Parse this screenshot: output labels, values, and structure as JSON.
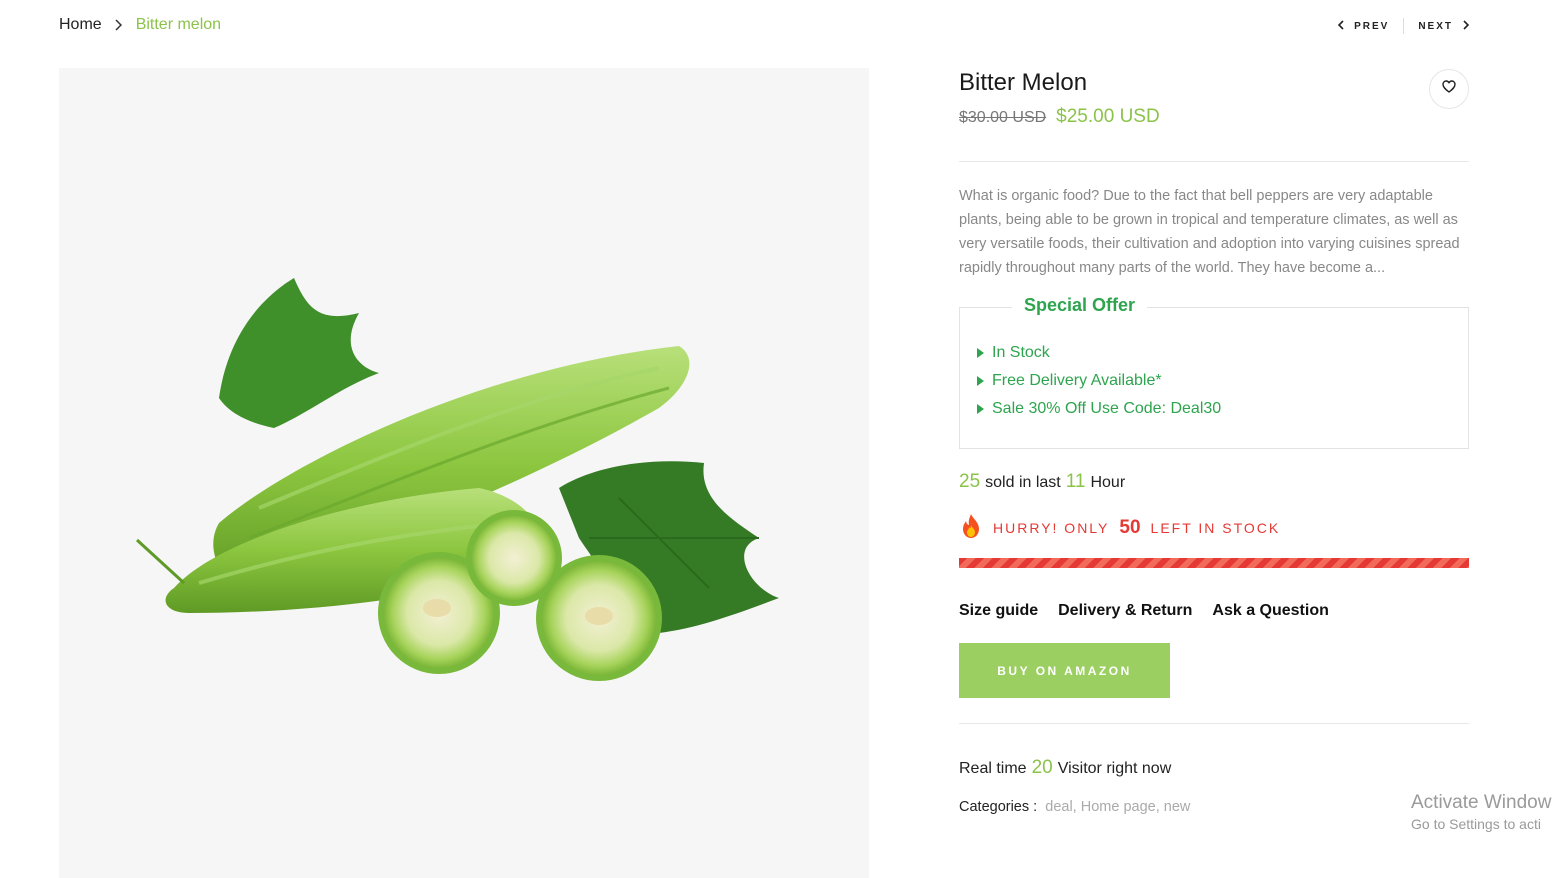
{
  "breadcrumb": {
    "home": "Home",
    "current": "Bitter melon"
  },
  "pager": {
    "prev": "PREV",
    "next": "NEXT"
  },
  "product": {
    "title": "Bitter Melon",
    "price_old": "$30.00 USD",
    "price_new": "$25.00 USD",
    "description": "What is organic food? Due to the fact that bell peppers are very adaptable plants, being able to be grown in tropical and temperature climates, as well as very versatile foods, their cultivation and adoption into varying cuisines spread rapidly throughout many parts of the world. They have become a...",
    "image_alt": "bitter-melon-photo"
  },
  "offer": {
    "title": "Special Offer",
    "items": [
      "In Stock",
      "Free Delivery Available*",
      "Sale 30% Off Use Code: Deal30"
    ]
  },
  "sold": {
    "count": "25",
    "text1": "sold in last",
    "hours": "11",
    "text2": "Hour"
  },
  "stock": {
    "prefix": "HURRY! ONLY",
    "count": "50",
    "suffix": "LEFT IN STOCK",
    "level_percent": 100
  },
  "links": {
    "size_guide": "Size guide",
    "delivery": "Delivery & Return",
    "ask": "Ask a Question"
  },
  "buy_button": "BUY ON AMAZON",
  "visitors": {
    "prefix": "Real time",
    "count": "20",
    "suffix": "Visitor right now"
  },
  "categories": {
    "label": "Categories :",
    "items": [
      "deal,",
      "Home page,",
      "new"
    ]
  },
  "watermark": {
    "line1": "Activate Window",
    "line2": "Go to Settings to acti"
  },
  "icons": {
    "breadcrumb_sep": "chevron-right-icon",
    "prev": "chevron-left-icon",
    "next": "chevron-right-icon",
    "wishlist": "heart-icon",
    "fire": "fire-icon"
  },
  "colors": {
    "accent": "#8bc34a",
    "offer_green": "#2ea44f",
    "alert_red": "#e53935",
    "button": "#9ccf62"
  }
}
